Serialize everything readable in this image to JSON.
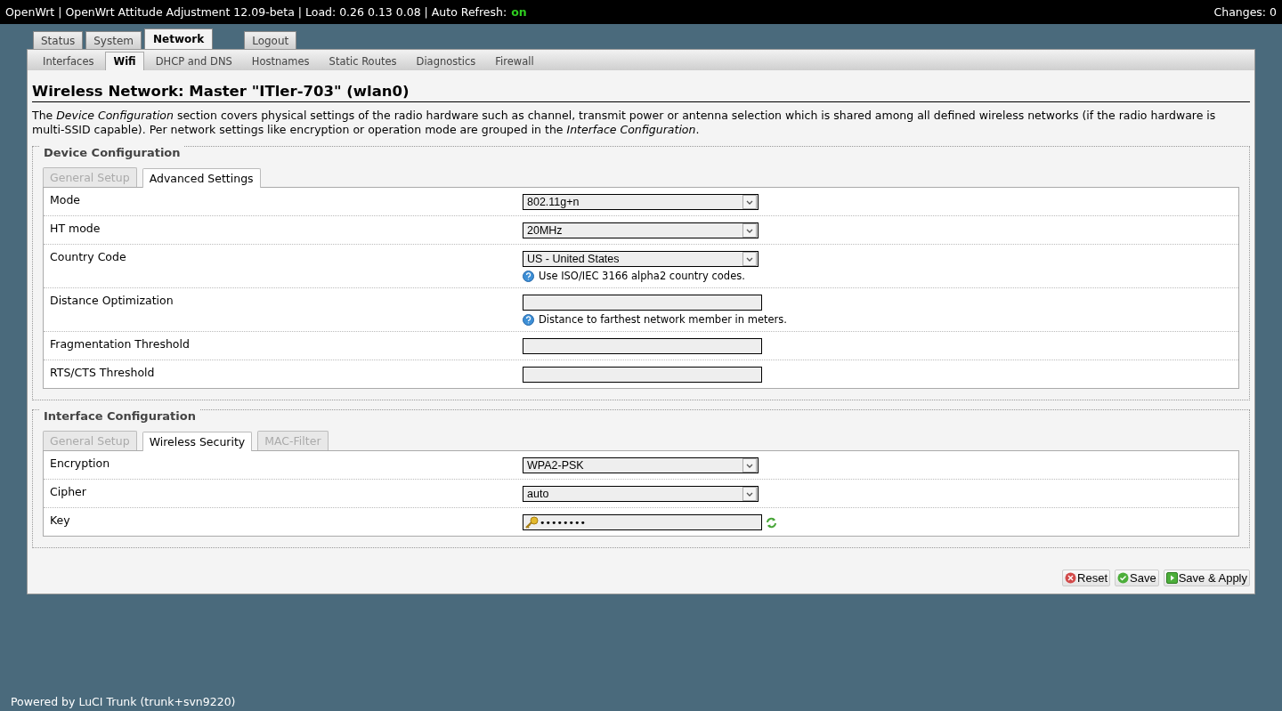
{
  "header": {
    "title": "OpenWrt | OpenWrt Attitude Adjustment 12.09-beta | Load: 0.26 0.13 0.08 | Auto Refresh:",
    "auto_refresh": "on",
    "changes": "Changes: 0"
  },
  "main_tabs": [
    {
      "label": "Status",
      "selected": false,
      "kind": "page"
    },
    {
      "label": "System",
      "selected": false,
      "kind": "page"
    },
    {
      "label": "Network",
      "selected": true,
      "kind": "page"
    },
    {
      "label": "Logout",
      "selected": false,
      "kind": "action"
    }
  ],
  "sub_tabs": [
    {
      "label": "Interfaces",
      "selected": false
    },
    {
      "label": "Wifi",
      "selected": true
    },
    {
      "label": "DHCP and DNS",
      "selected": false
    },
    {
      "label": "Hostnames",
      "selected": false
    },
    {
      "label": "Static Routes",
      "selected": false
    },
    {
      "label": "Diagnostics",
      "selected": false
    },
    {
      "label": "Firewall",
      "selected": false
    }
  ],
  "page_title": "Wireless Network: Master \"ITler-703\" (wlan0)",
  "description": "The *Device Configuration* section covers physical settings of the radio hardware such as channel, transmit power or antenna selection which is shared among all defined wireless networks (if the radio hardware is multi-SSID capable). Per network settings like encryption or operation mode are grouped in the *Interface Configuration*.",
  "sections": [
    {
      "legend": "Device Configuration",
      "tabs": [
        {
          "label": "General Setup",
          "selected": false
        },
        {
          "label": "Advanced Settings",
          "selected": true
        }
      ],
      "rows": [
        {
          "kind": "select",
          "label": "Mode",
          "value": "802.11g+n"
        },
        {
          "kind": "select",
          "label": "HT mode",
          "value": "20MHz"
        },
        {
          "kind": "select",
          "label": "Country Code",
          "value": "US - United States",
          "hint": "Use ISO/IEC 3166 alpha2 country codes."
        },
        {
          "kind": "text",
          "label": "Distance Optimization",
          "hint": "Distance to farthest network member in meters."
        },
        {
          "kind": "text",
          "label": "Fragmentation Threshold"
        },
        {
          "kind": "text",
          "label": "RTS/CTS Threshold"
        }
      ]
    },
    {
      "legend": "Interface Configuration",
      "tabs": [
        {
          "label": "General Setup",
          "selected": false
        },
        {
          "label": "Wireless Security",
          "selected": true
        },
        {
          "label": "MAC-Filter",
          "selected": false
        }
      ],
      "rows": [
        {
          "kind": "select",
          "label": "Encryption",
          "value": "WPA2-PSK"
        },
        {
          "kind": "select",
          "label": "Cipher",
          "value": "auto"
        },
        {
          "kind": "password",
          "label": "Key",
          "value": "••••••••"
        }
      ]
    }
  ],
  "buttons": [
    {
      "kind": "reset",
      "label": "Reset"
    },
    {
      "kind": "save",
      "label": "Save"
    },
    {
      "kind": "apply",
      "label": "Save & Apply"
    }
  ],
  "footer": "Powered by LuCI Trunk (trunk+svn9220)"
}
